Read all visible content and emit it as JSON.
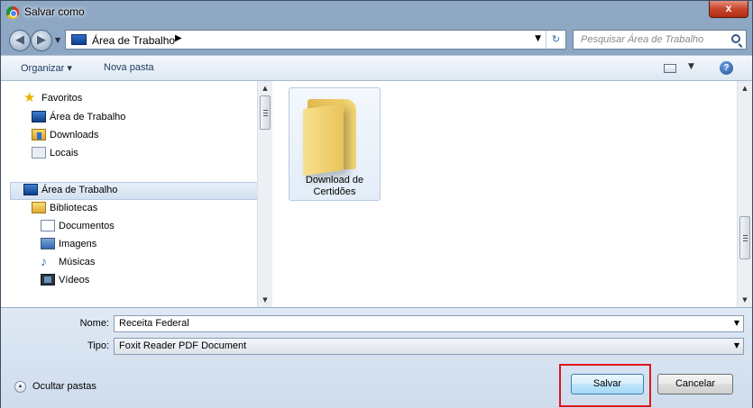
{
  "window": {
    "title": "Salvar como",
    "close_symbol": "x"
  },
  "navigation": {
    "address": "Área de Trabalho",
    "search_placeholder": "Pesquisar Área de Trabalho"
  },
  "toolbar": {
    "organize_label": "Organizar ▾",
    "new_folder_label": "Nova pasta",
    "help_symbol": "?"
  },
  "sidebar": {
    "items": [
      {
        "label": "Favoritos",
        "icon": "star-icon"
      },
      {
        "label": "Área de Trabalho",
        "icon": "desktop-icon"
      },
      {
        "label": "Downloads",
        "icon": "downloads-icon"
      },
      {
        "label": "Locais",
        "icon": "recent-places-icon"
      },
      {
        "label": "Área de Trabalho",
        "icon": "desktop-icon"
      },
      {
        "label": "Bibliotecas",
        "icon": "libraries-icon"
      },
      {
        "label": "Documentos",
        "icon": "documents-icon"
      },
      {
        "label": "Imagens",
        "icon": "pictures-icon"
      },
      {
        "label": "Músicas",
        "icon": "music-icon"
      },
      {
        "label": "Vídeos",
        "icon": "videos-icon"
      }
    ]
  },
  "files": [
    {
      "label": "Download de Certidões",
      "icon": "folder-icon"
    }
  ],
  "form": {
    "name_label": "Nome:",
    "name_value": "Receita Federal",
    "type_label": "Tipo:",
    "type_value": "Foxit Reader PDF Document"
  },
  "footer": {
    "hide_folders_label": "Ocultar pastas",
    "save_label": "Salvar",
    "cancel_label": "Cancelar"
  },
  "colors": {
    "highlight": "#e0131b",
    "title_bar": "#8fa9c5"
  }
}
